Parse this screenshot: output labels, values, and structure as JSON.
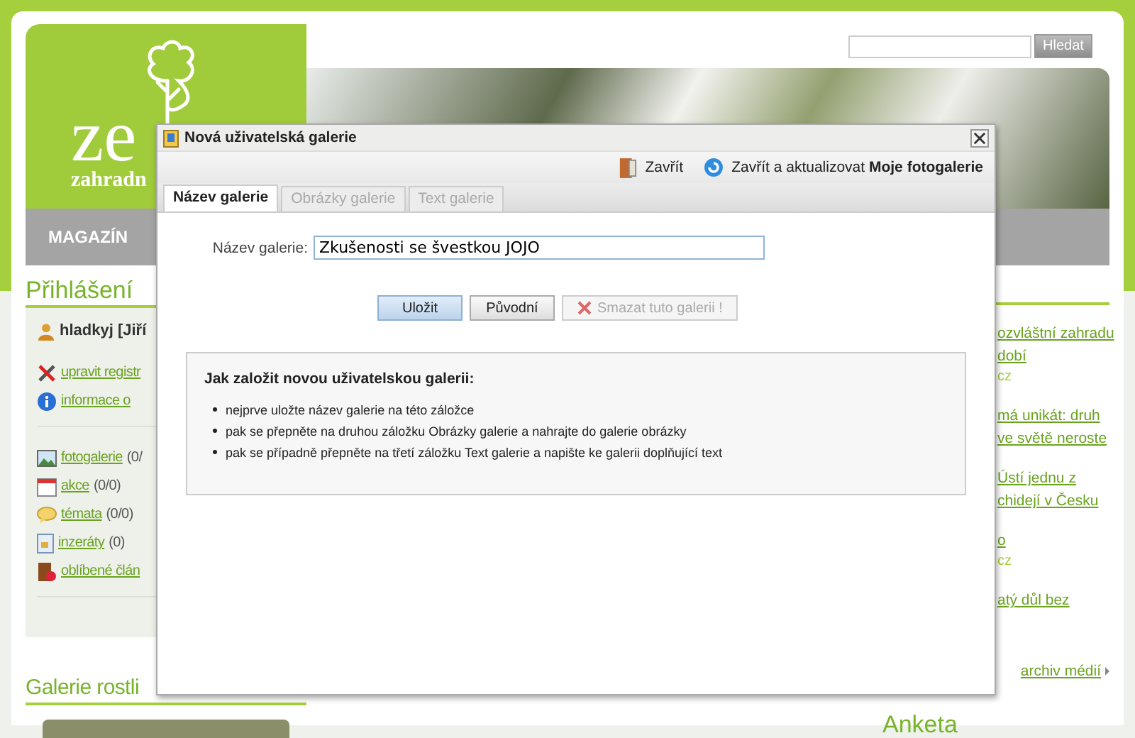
{
  "header": {
    "logo": {
      "text": "ze",
      "subtitle": "zahradn"
    },
    "search": {
      "button": "Hledat"
    },
    "nav": [
      "MAGAZÍN"
    ]
  },
  "login": {
    "title": "Přihlášení",
    "user": "hladkyj [Jiří",
    "account_links": [
      {
        "kind": "tools",
        "label": "upravit registr"
      },
      {
        "kind": "info",
        "label": "informace o"
      }
    ],
    "content_links": [
      {
        "kind": "photo",
        "label": "fotogalerie",
        "count": "(0/"
      },
      {
        "kind": "calendar",
        "label": "akce",
        "count": "(0/0)"
      },
      {
        "kind": "bubble",
        "label": "témata",
        "count": "(0/0)"
      },
      {
        "kind": "ad",
        "label": "inzeráty",
        "count": "(0)"
      },
      {
        "kind": "book",
        "label": "oblíbené člán"
      }
    ]
  },
  "gallery": {
    "title": "Galerie rostli"
  },
  "media": {
    "items": [
      {
        "lines": [
          "ozvláštní zahradu",
          "dobí"
        ],
        "source": "cz"
      },
      {
        "lines": [
          "má unikát: druh",
          "ve světě neroste"
        ]
      },
      {
        "lines": [
          "Ústí jednu z",
          "chidejí v Česku"
        ]
      },
      {
        "lines": [
          "o"
        ],
        "source": "cz"
      },
      {
        "lines": [
          "atý důl bez"
        ]
      }
    ],
    "archive": "archiv médií"
  },
  "poll": {
    "title": "Anketa"
  },
  "dialog": {
    "title": "Nová uživatelská galerie",
    "toolbar": [
      {
        "kind": "door",
        "label": "Zavřít"
      },
      {
        "kind": "refresh",
        "label": "Zavřít a aktualizovat **Moje fotogalerie**"
      }
    ],
    "tabs": [
      {
        "label": "Název galerie",
        "selected": true,
        "disabled": false
      },
      {
        "label": "Obrázky galerie",
        "selected": false,
        "disabled": true
      },
      {
        "label": "Text galerie",
        "selected": false,
        "disabled": true
      }
    ],
    "field": {
      "label": "Název galerie:",
      "value": "Zkušenosti se švestkou JOJO"
    },
    "buttons": [
      {
        "kind": "primary",
        "label": "Uložit",
        "disabled": false
      },
      {
        "kind": "default",
        "label": "Původní",
        "disabled": false
      },
      {
        "kind": "delete",
        "label": "Smazat tuto galerii !",
        "disabled": true
      }
    ],
    "help": {
      "title": "Jak založit novou uživatelskou galerii:",
      "items": [
        "nejprve uložte název galerie na této záložce",
        "pak se přepněte na druhou záložku Obrázky galerie a nahrajte do galerie obrázky",
        "pak se případně přepněte na třetí záložku Text galerie a napište ke galerii doplňující text"
      ]
    }
  }
}
